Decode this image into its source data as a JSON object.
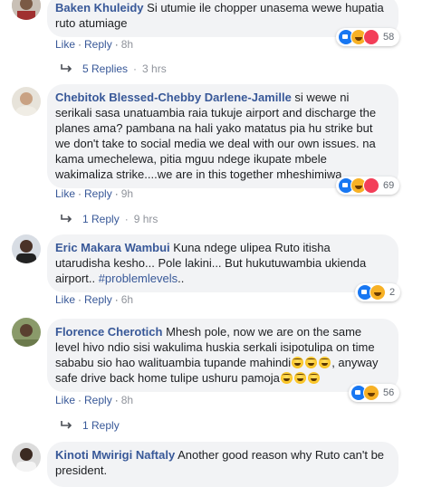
{
  "actions": {
    "like": "Like",
    "reply": "Reply",
    "sep": "·"
  },
  "comments": [
    {
      "name": "Baken Khuleidy",
      "text": " Si utumie ile chopper unasema wewe hupatia ruto atumiage",
      "time": "8h",
      "reactions": "58",
      "replies": "5 Replies",
      "replies_time": "3 hrs"
    },
    {
      "name": "Chebitok Blessed-Chebby Darlene-Jamille",
      "text": " si wewe ni serikali sasa unatuambia raia tukuje airport and discharge the planes ama? pambana na hali yako matatus pia hu strike but we don't take to social media we deal with our own issues. na kama umechelewa, pitia mguu ndege ikupate mbele wakimaliza strike....we are in this together mheshimiwa",
      "time": "9h",
      "reactions": "69",
      "replies": "1 Reply",
      "replies_time": "9 hrs"
    },
    {
      "name": "Eric Makara Wambui",
      "text": " Kuna ndege ulipea Ruto itisha utarudisha kesho... Pole lakini... But hukutuwambia ukienda airport.. ",
      "tag": "#problemlevels",
      "text_end": "..",
      "time": "6h",
      "reactions": "2"
    },
    {
      "name": "Florence Cherotich",
      "text": " Mhesh pole, now we are on the same level hivo ndio sisi wakulima huskia serkali isipotulipa on time sababu sio hao walituambia tupande mahindi",
      "text_mid": ", anyway safe drive back home tulipe ushuru pamoja",
      "time": "8h",
      "reactions": "56",
      "replies": "1 Reply"
    },
    {
      "name": "Kinoti Mwirigi Naftaly",
      "text": " Another good reason why Ruto can't be president."
    }
  ]
}
